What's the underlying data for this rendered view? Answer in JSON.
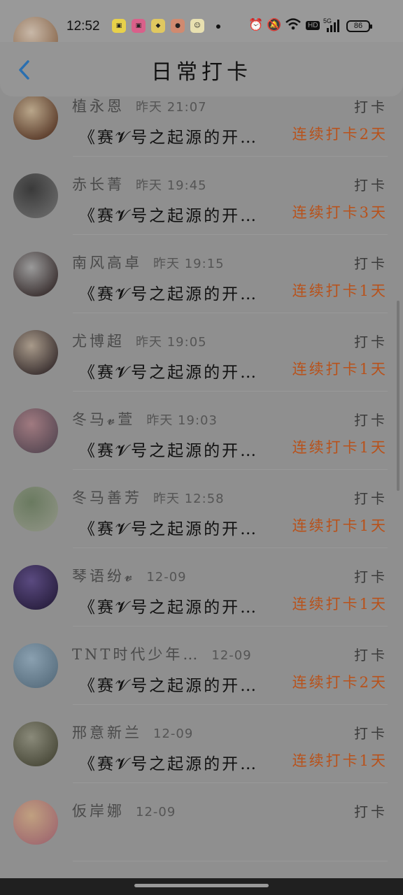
{
  "status_bar": {
    "time": "12:52",
    "battery": "86",
    "hd_label": "HD",
    "network": "5G",
    "icons": [
      "alarm-icon",
      "mute-icon",
      "wifi-icon",
      "signal-icon"
    ]
  },
  "header": {
    "title": "日常打卡",
    "back_icon": "chevron-left-icon"
  },
  "colors": {
    "streak": "#b8521b",
    "accent": "#2a6fb0"
  },
  "list": [
    {
      "name": "",
      "time": "",
      "action": "",
      "text": "《赛𝓥号之起源的开…",
      "streak": "连续打卡2天",
      "avatar": [
        "#c8b8a8",
        "#8a6a50"
      ]
    },
    {
      "name": "植永恩",
      "time": "昨天 21:07",
      "action": "打卡",
      "text": "《赛𝓥号之起源的开…",
      "streak": "连续打卡2天",
      "avatar": [
        "#b9a68a",
        "#5a3b2a"
      ]
    },
    {
      "name": "赤长菁",
      "time": "昨天 19:45",
      "action": "打卡",
      "text": "《赛𝓥号之起源的开…",
      "streak": "连续打卡3天",
      "avatar": [
        "#3a3a3a",
        "#666666"
      ]
    },
    {
      "name": "南风高卓",
      "time": "昨天 19:15",
      "action": "打卡",
      "text": "《赛𝓥号之起源的开…",
      "streak": "连续打卡1天",
      "avatar": [
        "#9a9a9a",
        "#3a3030"
      ]
    },
    {
      "name": "尤博超",
      "time": "昨天 19:05",
      "action": "打卡",
      "text": "《赛𝓥号之起源的开…",
      "streak": "连续打卡1天",
      "avatar": [
        "#a89a8a",
        "#3a3030"
      ]
    },
    {
      "name": "冬马𝓿萱",
      "time": "昨天 19:03",
      "action": "打卡",
      "text": "《赛𝓥号之起源的开…",
      "streak": "连续打卡1天",
      "avatar": [
        "#a07a80",
        "#5a4a55"
      ]
    },
    {
      "name": "冬马善芳",
      "time": "昨天 12:58",
      "action": "打卡",
      "text": "《赛𝓥号之起源的开…",
      "streak": "连续打卡1天",
      "avatar": [
        "#6a7a60",
        "#8a9080"
      ]
    },
    {
      "name": "琴语纷𝓿",
      "time": "12-09",
      "action": "打卡",
      "text": "《赛𝓥号之起源的开…",
      "streak": "连续打卡1天",
      "avatar": [
        "#5a4a80",
        "#2a2040"
      ]
    },
    {
      "name": "TNT时代少年…",
      "time": "12-09",
      "action": "打卡",
      "text": "《赛𝓥号之起源的开…",
      "streak": "连续打卡2天",
      "avatar": [
        "#8aa0b0",
        "#5a7080"
      ]
    },
    {
      "name": "邢意新兰",
      "time": "12-09",
      "action": "打卡",
      "text": "《赛𝓥号之起源的开…",
      "streak": "连续打卡1天",
      "avatar": [
        "#8a8a7a",
        "#4a4a3a"
      ]
    },
    {
      "name": "仮岸娜",
      "time": "12-09",
      "action": "打卡",
      "text": "",
      "streak": "",
      "avatar": [
        "#c0a080",
        "#a06a70"
      ]
    }
  ]
}
